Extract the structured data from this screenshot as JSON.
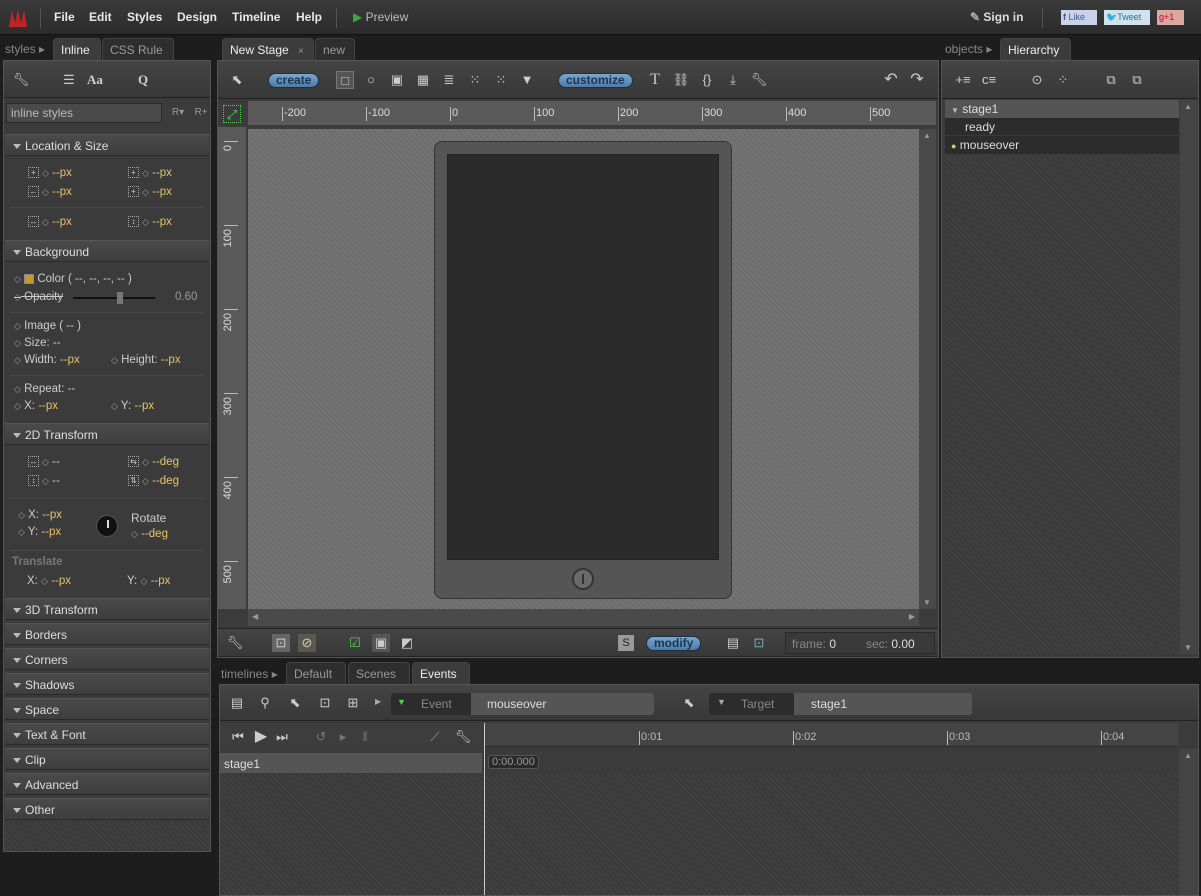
{
  "topbar": {
    "menus": [
      "File",
      "Edit",
      "Styles",
      "Design",
      "Timeline",
      "Help"
    ],
    "preview": "Preview",
    "sign_in": "Sign in",
    "like": "Like",
    "tweet": "Tweet",
    "plus_one": "+1"
  },
  "styles_panel": {
    "crumb": "styles",
    "tabs": [
      "Inline",
      "CSS Rule"
    ],
    "search_value": "inline styles",
    "sections": {
      "location": "Location & Size",
      "background": "Background",
      "transform2d": "2D Transform",
      "collapsed": [
        "3D Transform",
        "Borders",
        "Corners",
        "Shadows",
        "Space",
        "Text & Font",
        "Clip",
        "Advanced",
        "Other"
      ]
    },
    "px": "--px",
    "dash": "--",
    "deg": "--deg",
    "color": "Color ( --, --, --, -- )",
    "opacity_label": "Opacity",
    "opacity_value": "0.60",
    "opacity": 0.6,
    "image": "Image ( -- )",
    "size": "Size: --",
    "width": "Width: ",
    "height": "Height: ",
    "repeat": "Repeat: --",
    "x": "X: ",
    "y": "Y: ",
    "rotate": "Rotate",
    "translate": "Translate"
  },
  "stage": {
    "tabs": [
      "New Stage",
      "new"
    ],
    "create": "create",
    "customize": "customize",
    "modify": "modify",
    "s_label": "S",
    "frame_label": "frame:",
    "frame": "0",
    "sec_label": "sec:",
    "sec": "0.00",
    "h_ruler": [
      "-200",
      "-100",
      "0",
      "100",
      "200",
      "300",
      "400",
      "500"
    ],
    "v_ruler": [
      "0",
      "100",
      "200",
      "300",
      "400",
      "500"
    ]
  },
  "objects_panel": {
    "crumb": "objects",
    "tab": "Hierarchy",
    "tree": [
      {
        "label": "stage1",
        "level": 0
      },
      {
        "label": "ready",
        "level": 1
      },
      {
        "label": "mouseover",
        "level": 1,
        "active": true
      }
    ]
  },
  "timelines": {
    "crumb": "timelines",
    "tabs": [
      "Default",
      "Scenes",
      "Events"
    ],
    "event_label": "Event",
    "event_value": "mouseover",
    "target_label": "Target",
    "target_value": "stage1",
    "ticks": [
      "0:01",
      "0:02",
      "0:03",
      "0:04"
    ],
    "layer": "stage1",
    "time": "0:00.000"
  },
  "colors": {
    "accent": "#e6c36a",
    "pill": "#5d8ab5"
  }
}
